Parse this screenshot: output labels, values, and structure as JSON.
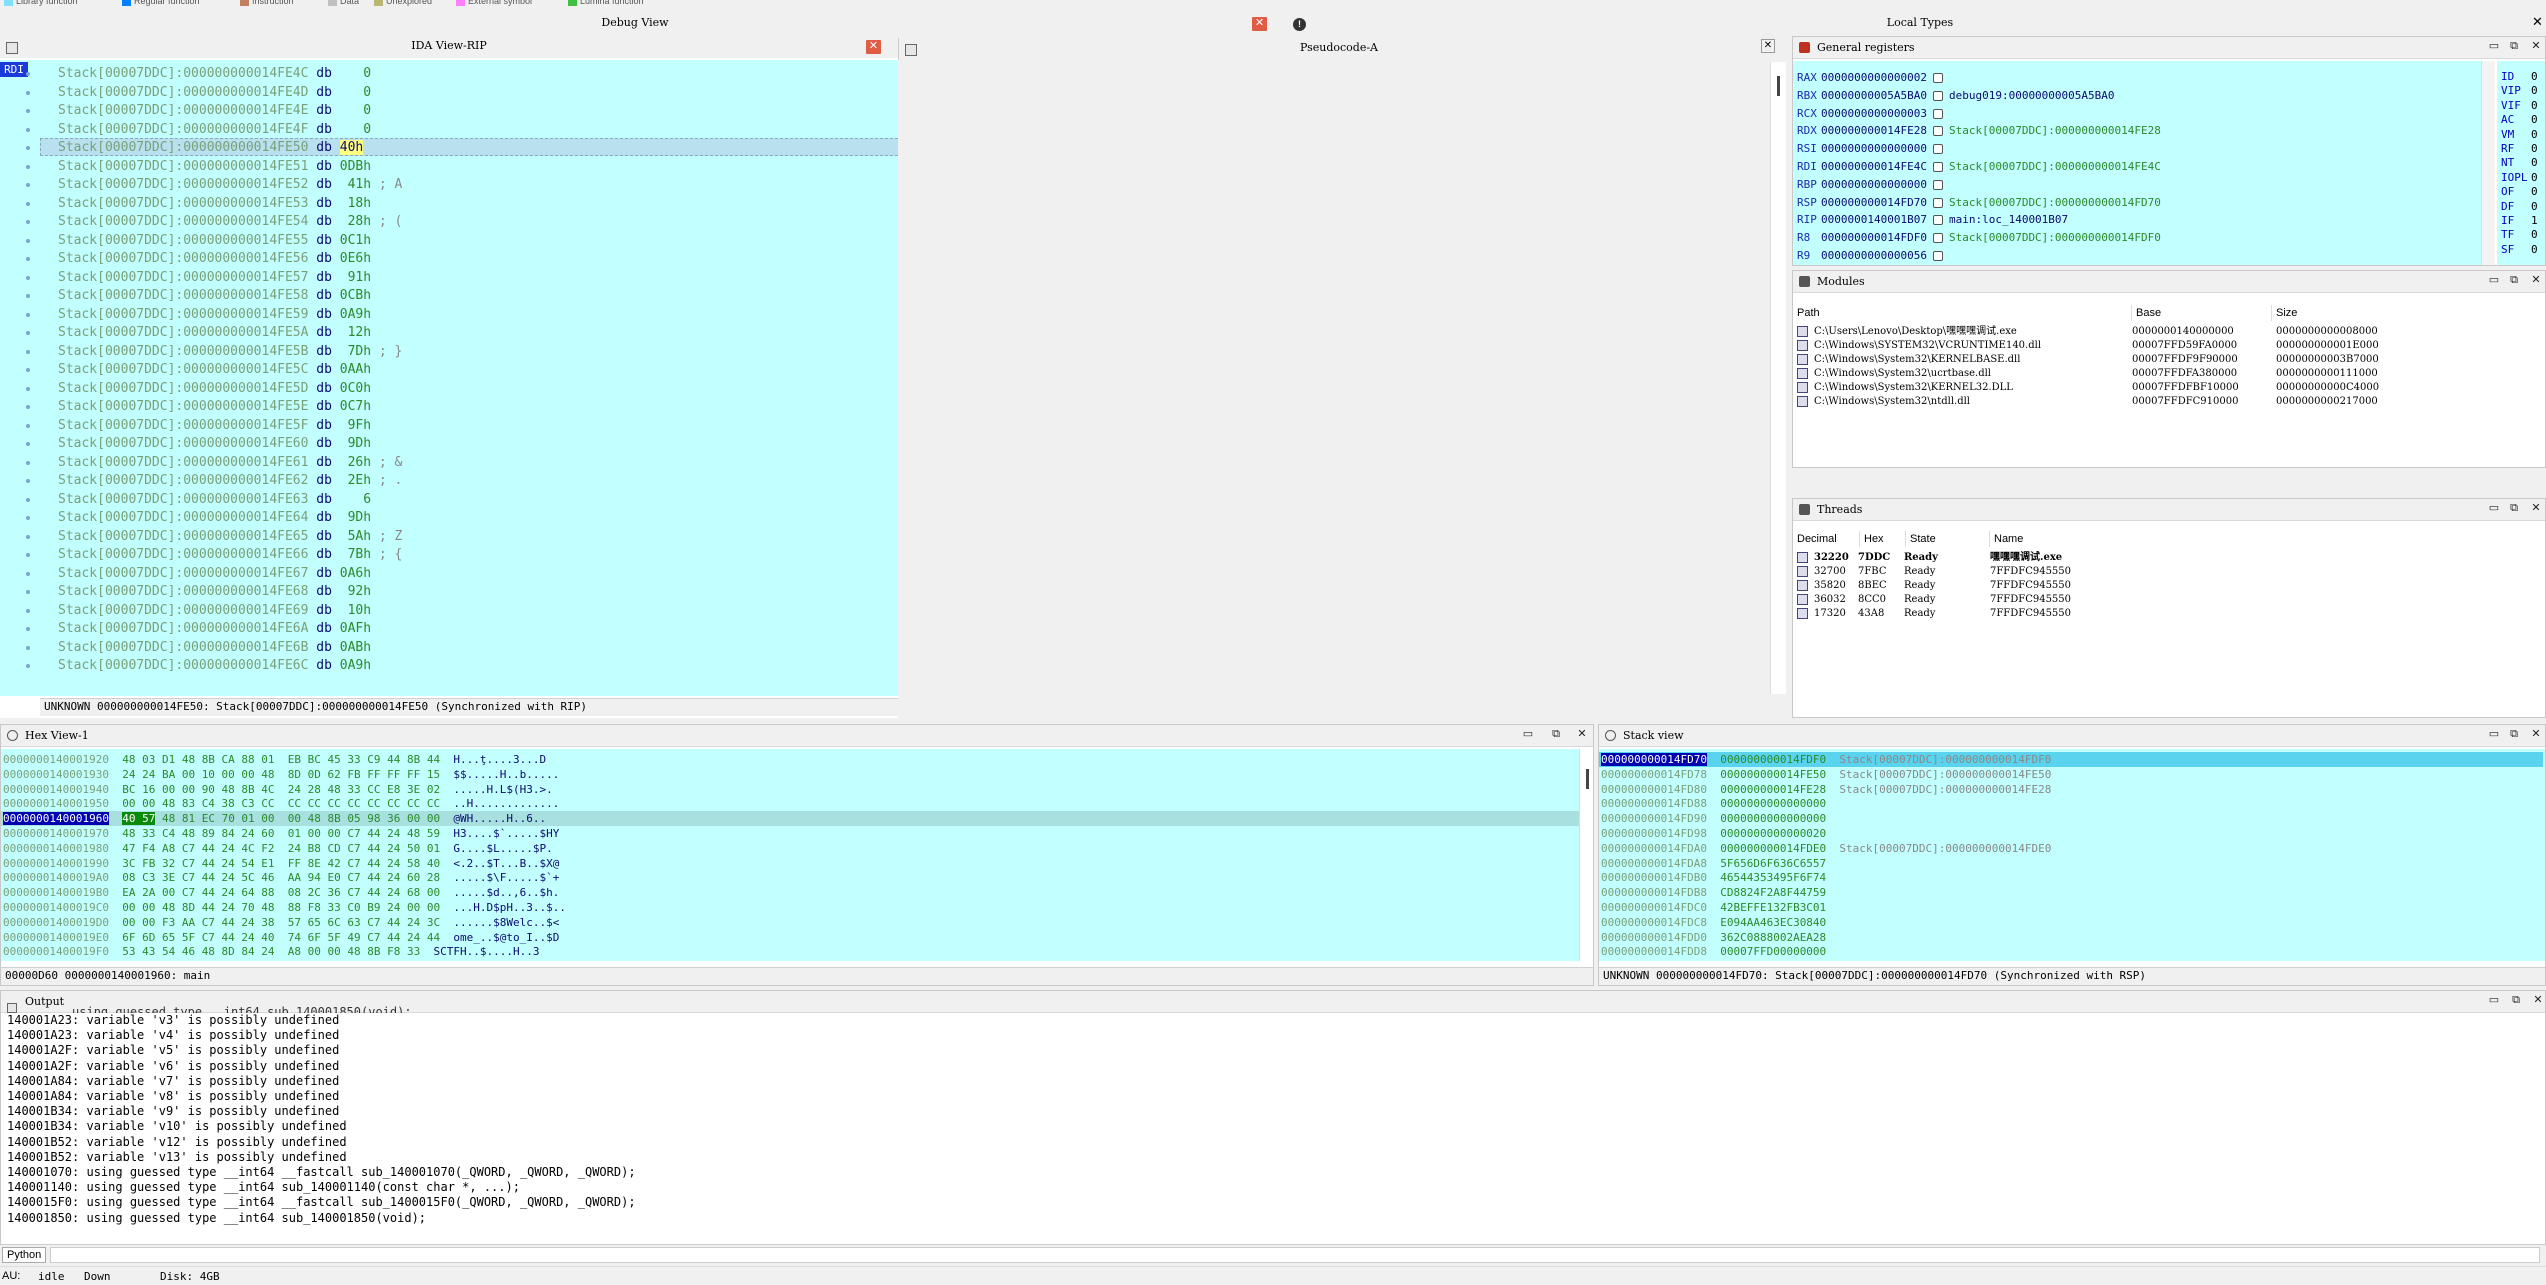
{
  "legend": [
    {
      "label": "Library function",
      "color": "#80e0ff"
    },
    {
      "label": "Regular function",
      "color": "#0080ff"
    },
    {
      "label": "Instruction",
      "color": "#c08060"
    },
    {
      "label": "Data",
      "color": "#c0c0c0"
    },
    {
      "label": "Unexplored",
      "color": "#b8b870"
    },
    {
      "label": "External symbol",
      "color": "#ff80ff"
    },
    {
      "label": "Lumina function",
      "color": "#40c040"
    }
  ],
  "tabs": {
    "debug_view": "Debug View",
    "local_types": "Local Types"
  },
  "ida_view": {
    "title": "IDA View-RIP",
    "reg_label": "RDI",
    "rows": [
      {
        "addr": "Stack[00007DDC]:000000000014FE4C",
        "op": "db",
        "val": "   0",
        "cmt": ""
      },
      {
        "addr": "Stack[00007DDC]:000000000014FE4D",
        "op": "db",
        "val": "   0",
        "cmt": ""
      },
      {
        "addr": "Stack[00007DDC]:000000000014FE4E",
        "op": "db",
        "val": "   0",
        "cmt": ""
      },
      {
        "addr": "Stack[00007DDC]:000000000014FE4F",
        "op": "db",
        "val": "   0",
        "cmt": ""
      },
      {
        "addr": "Stack[00007DDC]:000000000014FE50",
        "op": "db",
        "val": "40h",
        "cmt": ""
      },
      {
        "addr": "Stack[00007DDC]:000000000014FE51",
        "op": "db",
        "val": "0DBh",
        "cmt": ""
      },
      {
        "addr": "Stack[00007DDC]:000000000014FE52",
        "op": "db",
        "val": " 41h",
        "cmt": "; A"
      },
      {
        "addr": "Stack[00007DDC]:000000000014FE53",
        "op": "db",
        "val": " 18h",
        "cmt": ""
      },
      {
        "addr": "Stack[00007DDC]:000000000014FE54",
        "op": "db",
        "val": " 28h",
        "cmt": "; ("
      },
      {
        "addr": "Stack[00007DDC]:000000000014FE55",
        "op": "db",
        "val": "0C1h",
        "cmt": ""
      },
      {
        "addr": "Stack[00007DDC]:000000000014FE56",
        "op": "db",
        "val": "0E6h",
        "cmt": ""
      },
      {
        "addr": "Stack[00007DDC]:000000000014FE57",
        "op": "db",
        "val": " 91h",
        "cmt": ""
      },
      {
        "addr": "Stack[00007DDC]:000000000014FE58",
        "op": "db",
        "val": "0CBh",
        "cmt": ""
      },
      {
        "addr": "Stack[00007DDC]:000000000014FE59",
        "op": "db",
        "val": "0A9h",
        "cmt": ""
      },
      {
        "addr": "Stack[00007DDC]:000000000014FE5A",
        "op": "db",
        "val": " 12h",
        "cmt": ""
      },
      {
        "addr": "Stack[00007DDC]:000000000014FE5B",
        "op": "db",
        "val": " 7Dh",
        "cmt": "; }"
      },
      {
        "addr": "Stack[00007DDC]:000000000014FE5C",
        "op": "db",
        "val": "0AAh",
        "cmt": ""
      },
      {
        "addr": "Stack[00007DDC]:000000000014FE5D",
        "op": "db",
        "val": "0C0h",
        "cmt": ""
      },
      {
        "addr": "Stack[00007DDC]:000000000014FE5E",
        "op": "db",
        "val": "0C7h",
        "cmt": ""
      },
      {
        "addr": "Stack[00007DDC]:000000000014FE5F",
        "op": "db",
        "val": " 9Fh",
        "cmt": ""
      },
      {
        "addr": "Stack[00007DDC]:000000000014FE60",
        "op": "db",
        "val": " 9Dh",
        "cmt": ""
      },
      {
        "addr": "Stack[00007DDC]:000000000014FE61",
        "op": "db",
        "val": " 26h",
        "cmt": "; &"
      },
      {
        "addr": "Stack[00007DDC]:000000000014FE62",
        "op": "db",
        "val": " 2Eh",
        "cmt": "; ."
      },
      {
        "addr": "Stack[00007DDC]:000000000014FE63",
        "op": "db",
        "val": "   6",
        "cmt": ""
      },
      {
        "addr": "Stack[00007DDC]:000000000014FE64",
        "op": "db",
        "val": " 9Dh",
        "cmt": ""
      },
      {
        "addr": "Stack[00007DDC]:000000000014FE65",
        "op": "db",
        "val": " 5Ah",
        "cmt": "; Z"
      },
      {
        "addr": "Stack[00007DDC]:000000000014FE66",
        "op": "db",
        "val": " 7Bh",
        "cmt": "; {"
      },
      {
        "addr": "Stack[00007DDC]:000000000014FE67",
        "op": "db",
        "val": "0A6h",
        "cmt": ""
      },
      {
        "addr": "Stack[00007DDC]:000000000014FE68",
        "op": "db",
        "val": " 92h",
        "cmt": ""
      },
      {
        "addr": "Stack[00007DDC]:000000000014FE69",
        "op": "db",
        "val": " 10h",
        "cmt": ""
      },
      {
        "addr": "Stack[00007DDC]:000000000014FE6A",
        "op": "db",
        "val": "0AFh",
        "cmt": ""
      },
      {
        "addr": "Stack[00007DDC]:000000000014FE6B",
        "op": "db",
        "val": "0ABh",
        "cmt": ""
      },
      {
        "addr": "Stack[00007DDC]:000000000014FE6C",
        "op": "db",
        "val": "0A9h",
        "cmt": ""
      }
    ],
    "status": "UNKNOWN 000000000014FE50: Stack[00007DDC]:000000000014FE50 (Synchronized with RIP)"
  },
  "pseudocode": {
    "title": "Pseudocode-A"
  },
  "registers": {
    "title": "General registers",
    "rows": [
      {
        "name": "RAX",
        "value": "0000000000000002",
        "ref": ""
      },
      {
        "name": "RBX",
        "value": "00000000005A5BA0",
        "ref": "debug019:00000000005A5BA0"
      },
      {
        "name": "RCX",
        "value": "0000000000000003",
        "ref": ""
      },
      {
        "name": "RDX",
        "value": "000000000014FE28",
        "ref": "Stack[00007DDC]:000000000014FE28"
      },
      {
        "name": "RSI",
        "value": "0000000000000000",
        "ref": ""
      },
      {
        "name": "RDI",
        "value": "000000000014FE4C",
        "ref": "Stack[00007DDC]:000000000014FE4C"
      },
      {
        "name": "RBP",
        "value": "0000000000000000",
        "ref": ""
      },
      {
        "name": "RSP",
        "value": "000000000014FD70",
        "ref": "Stack[00007DDC]:000000000014FD70"
      },
      {
        "name": "RIP",
        "value": "0000000140001B07",
        "ref": "main:loc_140001B07"
      },
      {
        "name": "R8",
        "value": "000000000014FDF0",
        "ref": "Stack[00007DDC]:000000000014FDF0"
      },
      {
        "name": "R9",
        "value": "0000000000000056",
        "ref": ""
      }
    ],
    "flags": [
      {
        "name": "ID",
        "value": "0"
      },
      {
        "name": "VIP",
        "value": "0"
      },
      {
        "name": "VIF",
        "value": "0"
      },
      {
        "name": "AC",
        "value": "0"
      },
      {
        "name": "VM",
        "value": "0"
      },
      {
        "name": "RF",
        "value": "0"
      },
      {
        "name": "NT",
        "value": "0"
      },
      {
        "name": "IOPL",
        "value": "0"
      },
      {
        "name": "OF",
        "value": "0"
      },
      {
        "name": "DF",
        "value": "0"
      },
      {
        "name": "IF",
        "value": "1"
      },
      {
        "name": "TF",
        "value": "0"
      },
      {
        "name": "SF",
        "value": "0"
      }
    ]
  },
  "modules": {
    "title": "Modules",
    "columns": [
      "Path",
      "Base",
      "Size"
    ],
    "rows": [
      {
        "path": "C:\\Users\\Lenovo\\Desktop\\嘿嘿嘿调试.exe",
        "base": "0000000140000000",
        "size": "0000000000008000"
      },
      {
        "path": "C:\\Windows\\SYSTEM32\\VCRUNTIME140.dll",
        "base": "00007FFD59FA0000",
        "size": "000000000001E000"
      },
      {
        "path": "C:\\Windows\\System32\\KERNELBASE.dll",
        "base": "00007FFDF9F90000",
        "size": "00000000003B7000"
      },
      {
        "path": "C:\\Windows\\System32\\ucrtbase.dll",
        "base": "00007FFDFA380000",
        "size": "0000000000111000"
      },
      {
        "path": "C:\\Windows\\System32\\KERNEL32.DLL",
        "base": "00007FFDFBF10000",
        "size": "00000000000C4000"
      },
      {
        "path": "C:\\Windows\\System32\\ntdll.dll",
        "base": "00007FFDFC910000",
        "size": "0000000000217000"
      }
    ]
  },
  "threads": {
    "title": "Threads",
    "columns": [
      "Decimal",
      "Hex",
      "State",
      "Name"
    ],
    "rows": [
      {
        "dec": "32220",
        "hex": "7DDC",
        "state": "Ready",
        "name": "嘿嘿嘿调试.exe"
      },
      {
        "dec": "32700",
        "hex": "7FBC",
        "state": "Ready",
        "name": "7FFDFC945550"
      },
      {
        "dec": "35820",
        "hex": "8BEC",
        "state": "Ready",
        "name": "7FFDFC945550"
      },
      {
        "dec": "36032",
        "hex": "8CC0",
        "state": "Ready",
        "name": "7FFDFC945550"
      },
      {
        "dec": "17320",
        "hex": "43A8",
        "state": "Ready",
        "name": "7FFDFC945550"
      }
    ]
  },
  "hex_view": {
    "title": "Hex View-1",
    "rows": [
      {
        "addr": "0000000140001920",
        "bytes": "48 03 D1 48 8B CA 88 01  EB BC 45 33 C9 44 8B 44",
        "ascii": "H...ţ....3...D"
      },
      {
        "addr": "0000000140001930",
        "bytes": "24 24 BA 00 10 00 00 48  8D 0D 62 FB FF FF FF 15",
        "ascii": "$$.....H..b....."
      },
      {
        "addr": "0000000140001940",
        "bytes": "BC 16 00 00 90 48 8B 4C  24 28 48 33 CC E8 3E 02",
        "ascii": ".....H.L$(H3.>."
      },
      {
        "addr": "0000000140001950",
        "bytes": "00 00 48 83 C4 38 C3 CC  CC CC CC CC CC CC CC CC",
        "ascii": "..H............."
      },
      {
        "addr": "0000000140001960",
        "bytes": "40 57 48 81 EC 70 01 00  00 48 8B 05 98 36 00 00",
        "ascii": "@WH.....H..6.."
      },
      {
        "addr": "0000000140001970",
        "bytes": "48 33 C4 48 89 84 24 60  01 00 00 C7 44 24 48 59",
        "ascii": "H3....$`.....$HY"
      },
      {
        "addr": "0000000140001980",
        "bytes": "47 F4 A8 C7 44 24 4C F2  24 B8 CD C7 44 24 50 01",
        "ascii": "G....$L.....$P."
      },
      {
        "addr": "0000000140001990",
        "bytes": "3C FB 32 C7 44 24 54 E1  FF 8E 42 C7 44 24 58 40",
        "ascii": "<.2..$T...B..$X@"
      },
      {
        "addr": "00000001400019A0",
        "bytes": "08 C3 3E C7 44 24 5C 46  AA 94 E0 C7 44 24 60 28",
        "ascii": ".....$\\F.....$`+"
      },
      {
        "addr": "00000001400019B0",
        "bytes": "EA 2A 00 C7 44 24 64 88  08 2C 36 C7 44 24 68 00",
        "ascii": ".....$d..,6..$h."
      },
      {
        "addr": "00000001400019C0",
        "bytes": "00 00 48 8D 44 24 70 48  88 F8 33 C0 B9 24 00 00",
        "ascii": "...H.D$pH..3..$.."
      },
      {
        "addr": "00000001400019D0",
        "bytes": "00 00 F3 AA C7 44 24 38  57 65 6C 63 C7 44 24 3C",
        "ascii": "......$8Welc..$<"
      },
      {
        "addr": "00000001400019E0",
        "bytes": "6F 6D 65 5F C7 44 24 40  74 6F 5F 49 C7 44 24 44",
        "ascii": "ome_..$@to_I..$D"
      },
      {
        "addr": "00000001400019F0",
        "bytes": "53 43 54 46 48 8D 84 24  A8 00 00 48 8B F8 33",
        "ascii": "SCTFH..$....H..3"
      }
    ],
    "status": "00000D60 0000000140001960: main"
  },
  "stack_view": {
    "title": "Stack view",
    "rows": [
      {
        "addr": "000000000014FD70",
        "val": "000000000014FDF0",
        "ref": "Stack[00007DDC]:000000000014FDF0"
      },
      {
        "addr": "000000000014FD78",
        "val": "000000000014FE50",
        "ref": "Stack[00007DDC]:000000000014FE50"
      },
      {
        "addr": "000000000014FD80",
        "val": "000000000014FE28",
        "ref": "Stack[00007DDC]:000000000014FE28"
      },
      {
        "addr": "000000000014FD88",
        "val": "0000000000000000",
        "ref": ""
      },
      {
        "addr": "000000000014FD90",
        "val": "0000000000000000",
        "ref": ""
      },
      {
        "addr": "000000000014FD98",
        "val": "0000000000000020",
        "ref": ""
      },
      {
        "addr": "000000000014FDA0",
        "val": "000000000014FDE0",
        "ref": "Stack[00007DDC]:000000000014FDE0"
      },
      {
        "addr": "000000000014FDA8",
        "val": "5F656D6F636C6557",
        "ref": ""
      },
      {
        "addr": "000000000014FDB0",
        "val": "46544353495F6F74",
        "ref": ""
      },
      {
        "addr": "000000000014FDB8",
        "val": "CD8824F2A8F44759",
        "ref": ""
      },
      {
        "addr": "000000000014FDC0",
        "val": "42BEFFE132FB3C01",
        "ref": ""
      },
      {
        "addr": "000000000014FDC8",
        "val": "E094AA463EC30840",
        "ref": ""
      },
      {
        "addr": "000000000014FDD0",
        "val": "362C0888002AEA28",
        "ref": ""
      },
      {
        "addr": "000000000014FDD8",
        "val": "00007FFD00000000",
        "ref": ""
      }
    ],
    "status": "UNKNOWN 000000000014FD70: Stack[00007DDC]:000000000014FD70 (Synchronized with RSP)"
  },
  "output": {
    "title": "Output",
    "lines": [
      "140001A23: variable 'v3' is possibly undefined",
      "140001A23: variable 'v4' is possibly undefined",
      "140001A2F: variable 'v5' is possibly undefined",
      "140001A2F: variable 'v6' is possibly undefined",
      "140001A84: variable 'v7' is possibly undefined",
      "140001A84: variable 'v8' is possibly undefined",
      "140001B34: variable 'v9' is possibly undefined",
      "140001B34: variable 'v10' is possibly undefined",
      "140001B52: variable 'v12' is possibly undefined",
      "140001B52: variable 'v13' is possibly undefined",
      "140001070: using guessed type __int64 __fastcall sub_140001070(_QWORD, _QWORD, _QWORD);",
      "140001140: using guessed type __int64 sub_140001140(const char *, ...);",
      "1400015F0: using guessed type __int64 __fastcall sub_1400015F0(_QWORD, _QWORD, _QWORD);",
      "140001850: using guessed type __int64 sub_140001850(void);"
    ],
    "python_tab": "Python"
  },
  "statusbar": {
    "au": "AU:",
    "state": "idle",
    "dir": "Down",
    "disk": "Disk: 4GB"
  }
}
